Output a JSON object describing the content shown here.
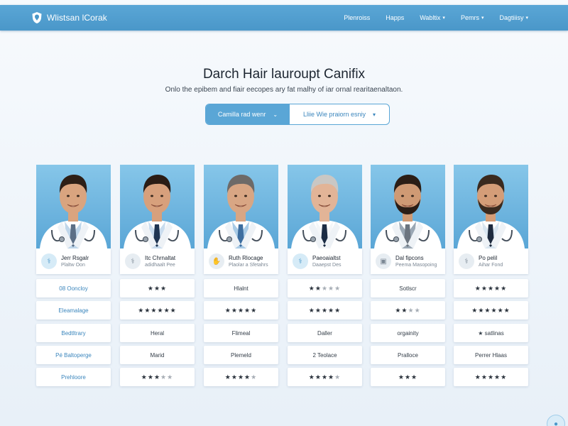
{
  "brand": {
    "name": "Wlistsan lCorak"
  },
  "nav": [
    {
      "label": "Plenroiss",
      "chevron": false
    },
    {
      "label": "Happs",
      "chevron": false
    },
    {
      "label": "Wabltix",
      "chevron": true
    },
    {
      "label": "Pemrs",
      "chevron": true
    },
    {
      "label": "Dagtiiisy",
      "chevron": true
    }
  ],
  "hero": {
    "title": "Darch Hair lauroupt Canifix",
    "subtitle": "Onlo the epibem and fiair eecopes ary fat malhy of iar ornal rearitaenaltaon.",
    "filter_primary": "Camilla rad wenr",
    "filter_secondary": "Lliie Wie praiorn esniy"
  },
  "doctors": [
    {
      "name": "Jerr Rsgalr",
      "role": "Plaltw Oon",
      "avatar_icon": "stethoscope-icon",
      "avatar_style": "blue"
    },
    {
      "name": "Itc Chrnaltat",
      "role": "adidhaalt Pee",
      "avatar_icon": "stethoscope-icon",
      "avatar_style": "grey"
    },
    {
      "name": "Ruth Rlocage",
      "role": "Plaolar a Sfetahrs",
      "avatar_icon": "hand-icon",
      "avatar_style": "grey"
    },
    {
      "name": "Paeoaialtst",
      "role": "Daaepst Des",
      "avatar_icon": "stethoscope-icon",
      "avatar_style": "blue"
    },
    {
      "name": "Dal fipcons",
      "role": "Peema Masopoing",
      "avatar_icon": "badge-icon",
      "avatar_style": "grey"
    },
    {
      "name": "Po pelil",
      "role": "Aihar Fond",
      "avatar_icon": "stethoscope-icon",
      "avatar_style": "grey"
    }
  ],
  "rows": [
    [
      {
        "text": "08 Ooncloy",
        "kind": "text",
        "accent": true
      },
      {
        "kind": "stars",
        "filled": 3,
        "total": 3
      },
      {
        "text": "Hlalnt",
        "kind": "text",
        "accent": false
      },
      {
        "kind": "stars",
        "filled": 2,
        "total": 5
      },
      {
        "text": "Sotlscr",
        "kind": "text",
        "accent": false
      },
      {
        "kind": "stars",
        "filled": 5,
        "total": 5
      }
    ],
    [
      {
        "text": "Eleamalage",
        "kind": "text",
        "accent": true
      },
      {
        "kind": "stars",
        "filled": 6,
        "total": 6
      },
      {
        "kind": "stars",
        "filled": 5,
        "total": 5
      },
      {
        "kind": "stars",
        "filled": 5,
        "total": 5
      },
      {
        "kind": "stars",
        "filled": 2,
        "total": 4
      },
      {
        "kind": "stars",
        "filled": 6,
        "total": 6
      }
    ],
    [
      {
        "text": "Bedtltrary",
        "kind": "text",
        "accent": true
      },
      {
        "text": "Heral",
        "kind": "text",
        "accent": false
      },
      {
        "text": "Flimeal",
        "kind": "text",
        "accent": false
      },
      {
        "text": "Daller",
        "kind": "text",
        "accent": false
      },
      {
        "text": "orgainity",
        "kind": "text",
        "accent": false
      },
      {
        "text": "★ satlinas",
        "kind": "text",
        "accent": false
      }
    ],
    [
      {
        "text": "Pé Baltoperge",
        "kind": "text",
        "accent": true
      },
      {
        "text": "Marid",
        "kind": "text",
        "accent": false
      },
      {
        "text": "Plemeld",
        "kind": "text",
        "accent": false
      },
      {
        "text": "2 Teolace",
        "kind": "text",
        "accent": false
      },
      {
        "text": "Pralloce",
        "kind": "text",
        "accent": false
      },
      {
        "text": "Perrer Hlaas",
        "kind": "text",
        "accent": false
      }
    ],
    [
      {
        "text": "Prehloore",
        "kind": "text",
        "accent": true
      },
      {
        "kind": "stars",
        "filled": 3,
        "total": 5
      },
      {
        "kind": "stars",
        "filled": 4,
        "total": 5
      },
      {
        "kind": "stars",
        "filled": 4,
        "total": 5
      },
      {
        "kind": "stars",
        "filled": 3,
        "total": 3
      },
      {
        "kind": "stars",
        "filled": 5,
        "total": 5
      }
    ]
  ],
  "colors": {
    "accent": "#5aa6d6",
    "accent_text": "#3b86bd",
    "nav_bg": "#4a97c9"
  }
}
